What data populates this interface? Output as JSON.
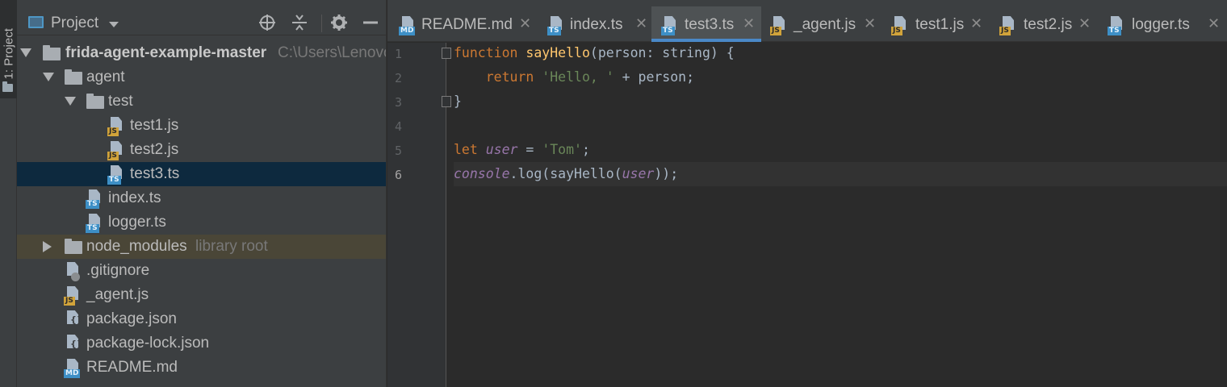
{
  "tool_strip": {
    "project_tab": "1: Project"
  },
  "project_panel": {
    "title": "Project",
    "tree": [
      {
        "label": "frida-agent-example-master",
        "hint": "C:\\Users\\Lenovo",
        "type": "root"
      },
      {
        "label": "agent",
        "type": "folder"
      },
      {
        "label": "test",
        "type": "folder"
      },
      {
        "label": "test1.js",
        "type": "js"
      },
      {
        "label": "test2.js",
        "type": "js"
      },
      {
        "label": "test3.ts",
        "type": "ts",
        "selected": true
      },
      {
        "label": "index.ts",
        "type": "ts"
      },
      {
        "label": "logger.ts",
        "type": "ts"
      },
      {
        "label": "node_modules",
        "hint": "library root",
        "type": "folder"
      },
      {
        "label": ".gitignore",
        "type": "git"
      },
      {
        "label": "_agent.js",
        "type": "js"
      },
      {
        "label": "package.json",
        "type": "json"
      },
      {
        "label": "package-lock.json",
        "type": "json"
      },
      {
        "label": "README.md",
        "type": "md"
      }
    ]
  },
  "tabs": [
    {
      "label": "README.md",
      "type": "md"
    },
    {
      "label": "index.ts",
      "type": "ts"
    },
    {
      "label": "test3.ts",
      "type": "ts",
      "active": true
    },
    {
      "label": "_agent.js",
      "type": "js"
    },
    {
      "label": "test1.js",
      "type": "js"
    },
    {
      "label": "test2.js",
      "type": "js"
    },
    {
      "label": "logger.ts",
      "type": "ts"
    }
  ],
  "editor": {
    "line_numbers": [
      "1",
      "2",
      "3",
      "4",
      "5",
      "6"
    ],
    "current_line": 6,
    "code": {
      "l1": {
        "kw": "function",
        "fn": "sayHello",
        "rest": "(person: string) {"
      },
      "l2": {
        "indent": "    ",
        "kw": "return",
        "sp": " ",
        "str": "'Hello, '",
        "rest": " + person;"
      },
      "l3": {
        "rest": "}"
      },
      "l5": {
        "kw": "let",
        "sp": " ",
        "var": "user",
        "mid": " = ",
        "str": "'Tom'",
        "rest": ";"
      },
      "l6": {
        "glob": "console",
        "a": ".log(sayHello(",
        "var": "user",
        "b": "));"
      }
    }
  },
  "icon_badges": {
    "js": "JS",
    "ts": "TS",
    "md": "MD"
  },
  "colors": {
    "keyword": "#cc7832",
    "function": "#ffc66d",
    "string": "#6a8759",
    "variable": "#9876aa",
    "selection": "#0d293e",
    "accent": "#4a88c7"
  }
}
